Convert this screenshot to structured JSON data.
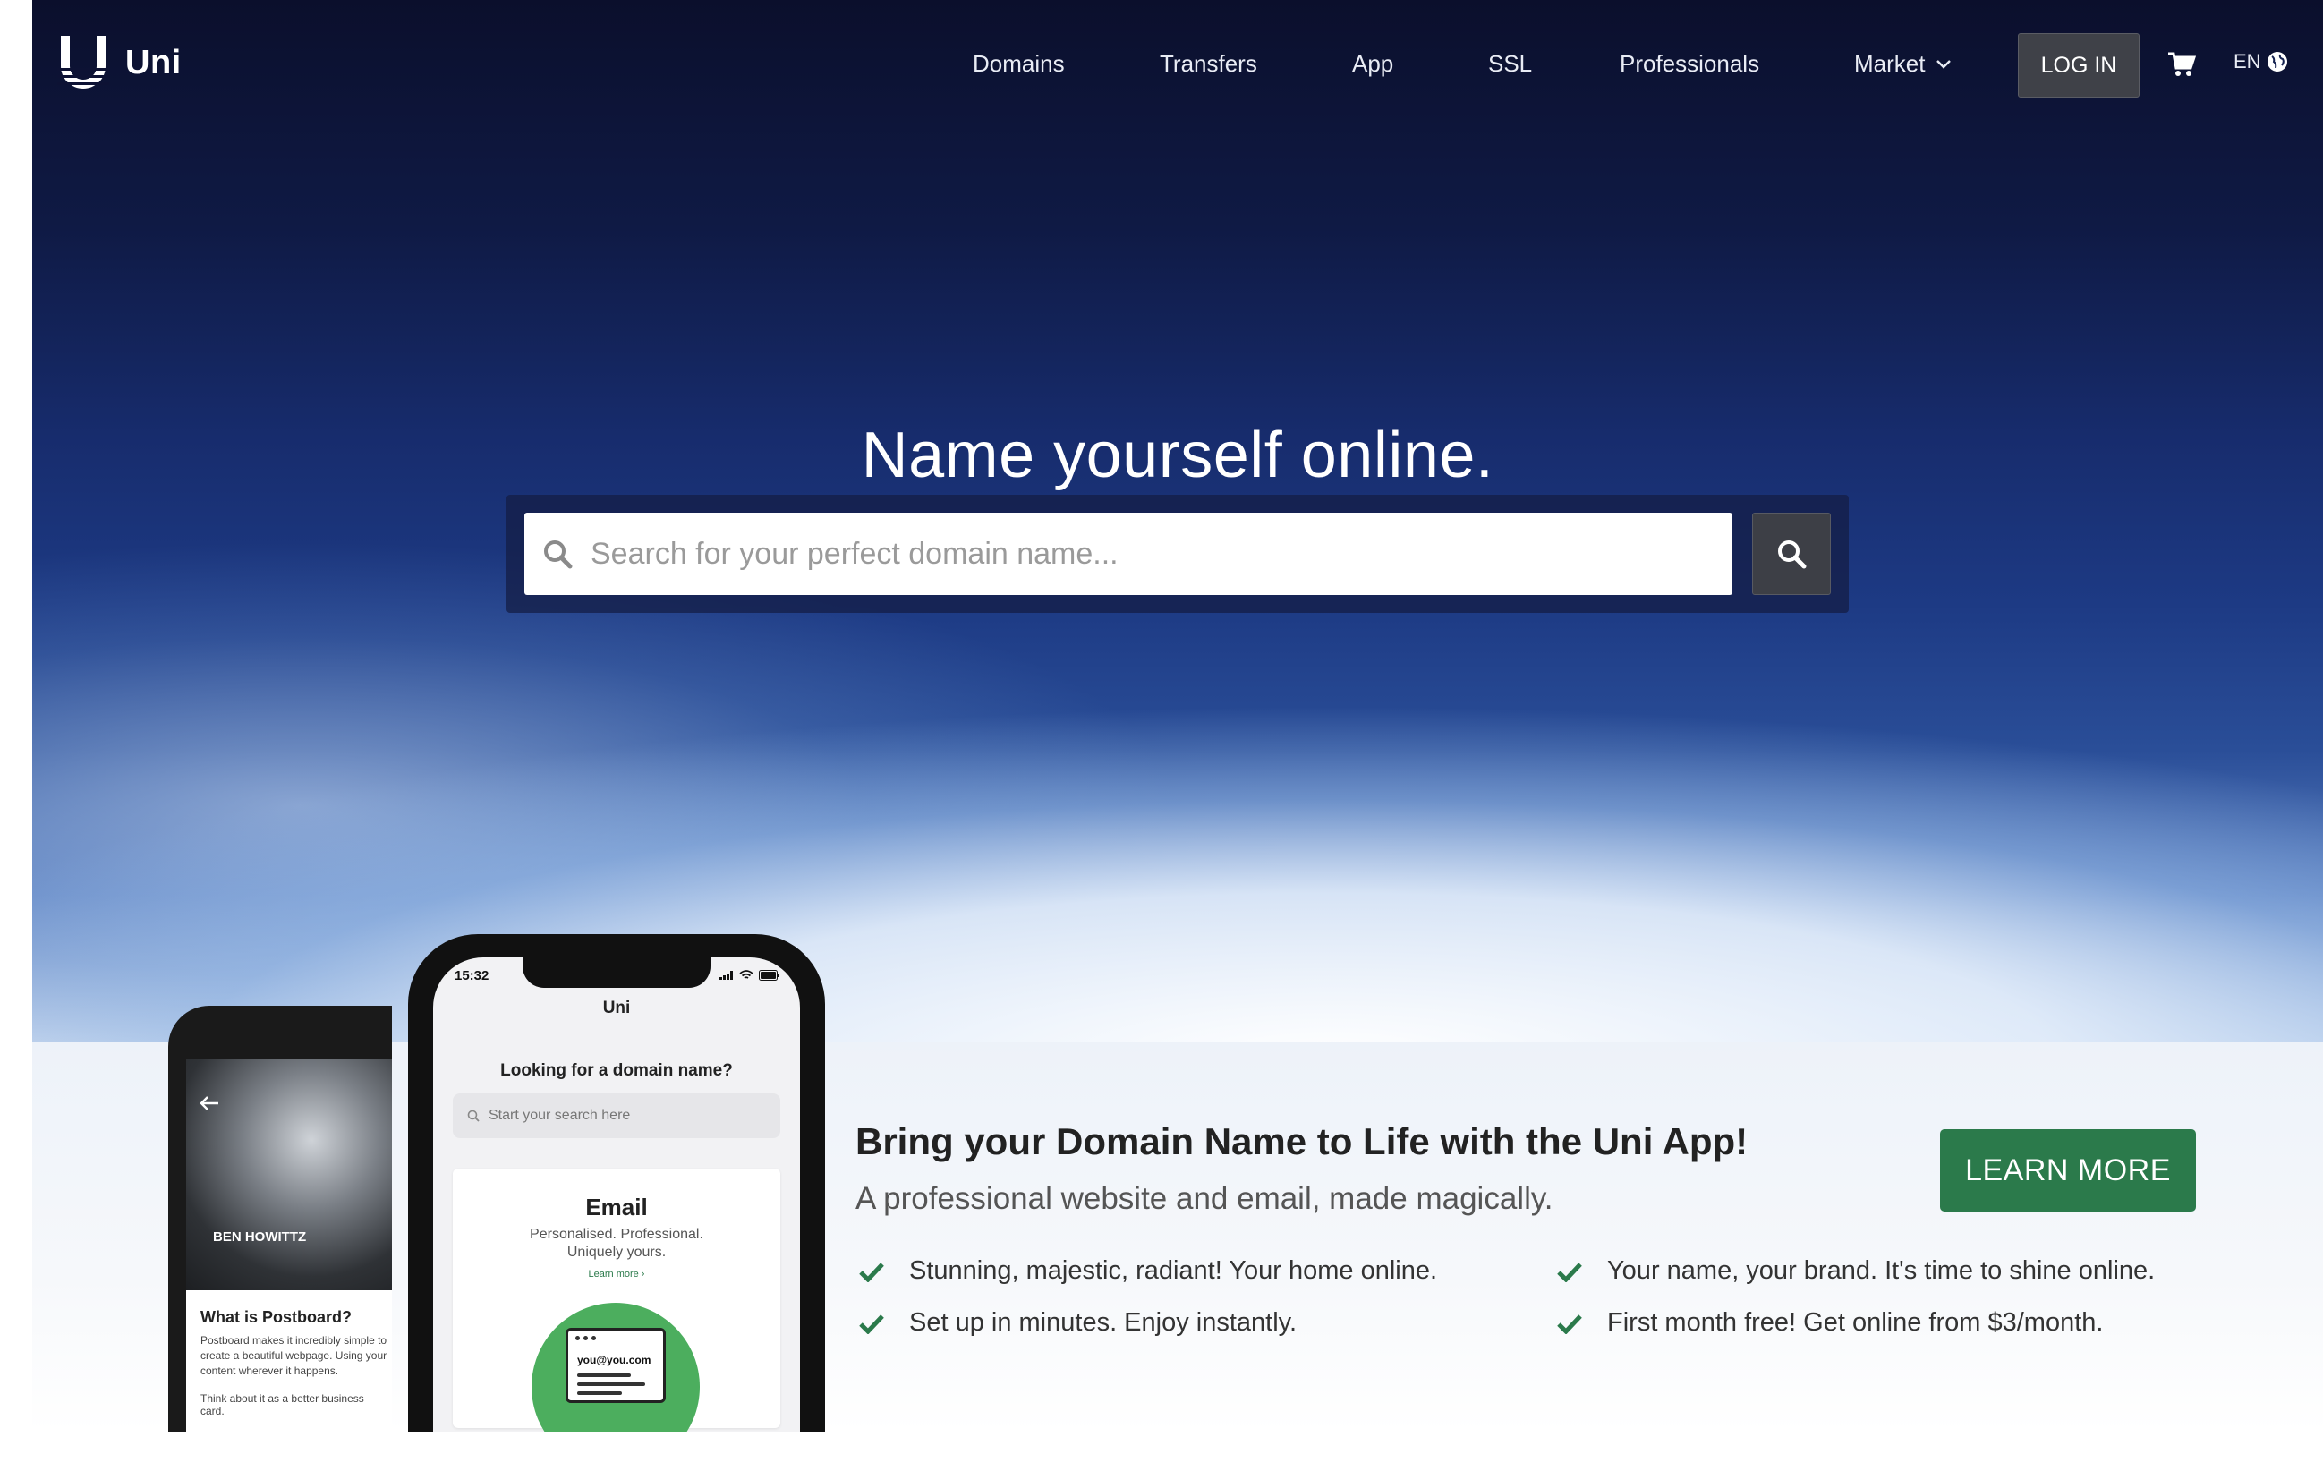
{
  "brand": {
    "name": "Uni"
  },
  "nav": {
    "links": [
      "Domains",
      "Transfers",
      "App",
      "SSL",
      "Professionals",
      "Market"
    ],
    "login_label": "LOG IN",
    "language": "EN"
  },
  "hero": {
    "headline": "Name yourself online.",
    "search_placeholder": "Search for your perfect domain name..."
  },
  "promo": {
    "title": "Bring your Domain Name to Life with the Uni App!",
    "subtitle": "A professional website and email, made magically.",
    "cta": "LEARN MORE",
    "features": [
      "Stunning, majestic, radiant! Your home online.",
      "Set up in minutes. Enjoy instantly.",
      "Your name, your brand. It's time to shine online.",
      "First month free! Get online from $3/month."
    ]
  },
  "phone_front": {
    "time": "15:32",
    "app_title": "Uni",
    "prompt": "Looking for a domain name?",
    "search_placeholder": "Start your search here",
    "card_title": "Email",
    "card_sub_1": "Personalised. Professional.",
    "card_sub_2": "Uniquely yours.",
    "card_link": "Learn more ›",
    "card_email": "you@you.com"
  },
  "phone_back": {
    "profile_name": "BEN HOWITTZ",
    "section_title": "What is Postboard?",
    "body_1": "Postboard makes it incredibly simple to create a beautiful webpage. Using your content wherever it happens.",
    "body_2": "Think about it as a better business card."
  },
  "colors": {
    "accent_green": "#2b7a4b",
    "login_bg": "#3f4148",
    "check_green": "#2b7a4b"
  }
}
